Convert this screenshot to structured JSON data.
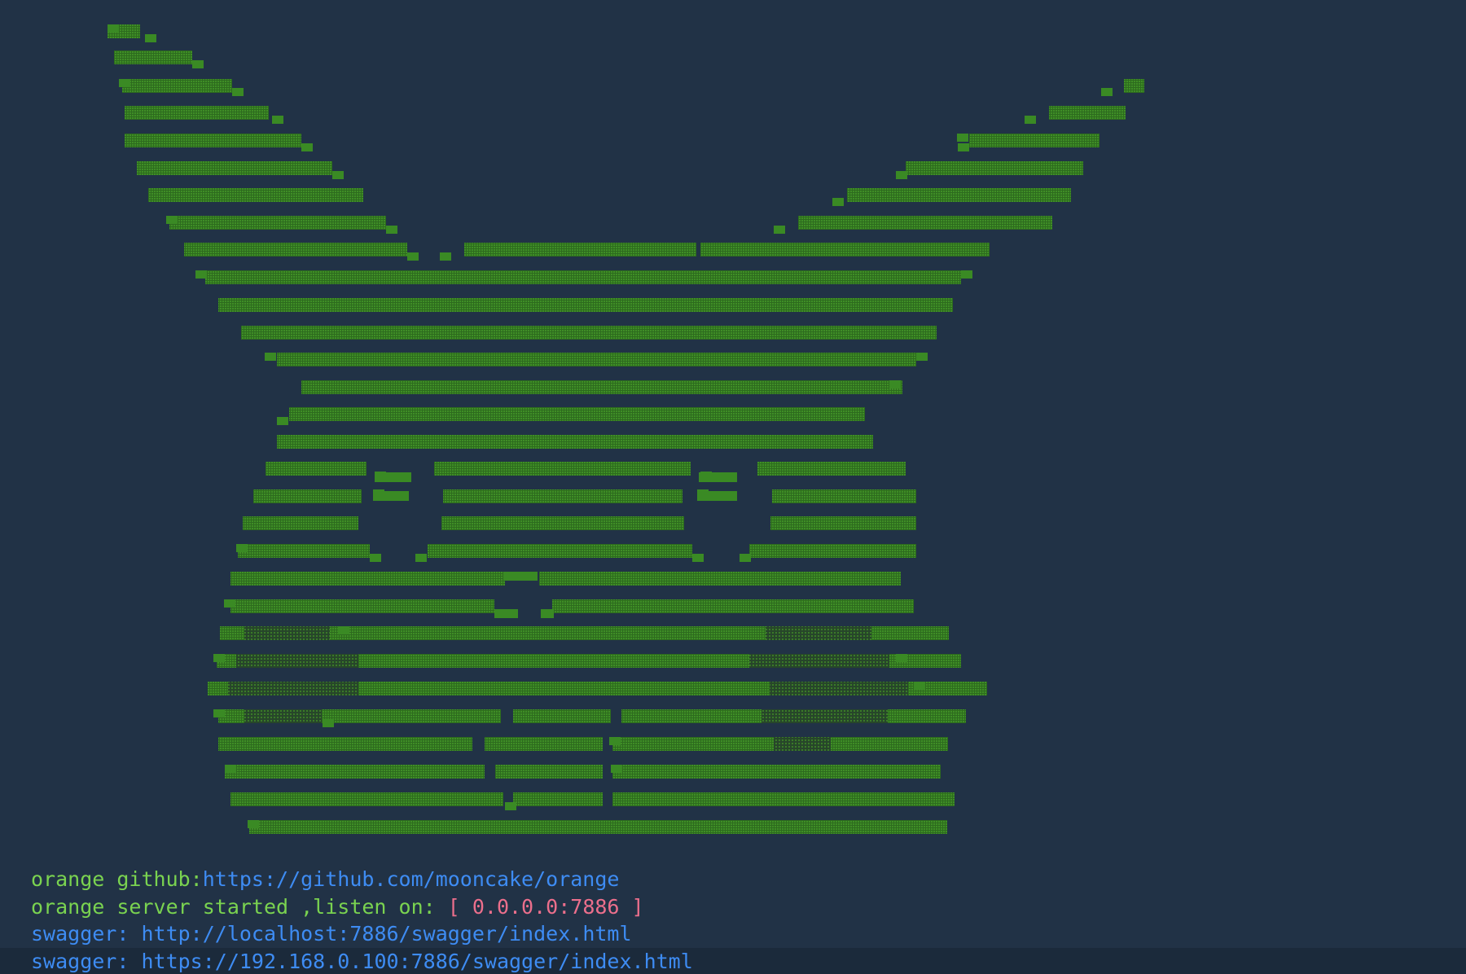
{
  "terminal": {
    "background": "#213246",
    "art_color": "#3a8a24",
    "art_description_icon": "pikachu-ascii-art"
  },
  "log": [
    {
      "prefix": "orange github:",
      "value": "https://github.com/mooncake/orange",
      "suffix": ""
    },
    {
      "prefix": "orange server started ,listen on: ",
      "value": "[ 0.0.0.0:7886 ]",
      "suffix": ""
    },
    {
      "prefix": "swagger: ",
      "value": "http://localhost:7886/swagger/index.html",
      "suffix": ""
    },
    {
      "prefix": "swagger: ",
      "value": "https://192.168.0.100:7886/swagger/index.html",
      "suffix": ""
    }
  ],
  "colors": {
    "green": "#7ad350",
    "blue": "#3e8cf3",
    "pink": "#ec6f8c",
    "current_line_bg": "#1b2a3b"
  }
}
